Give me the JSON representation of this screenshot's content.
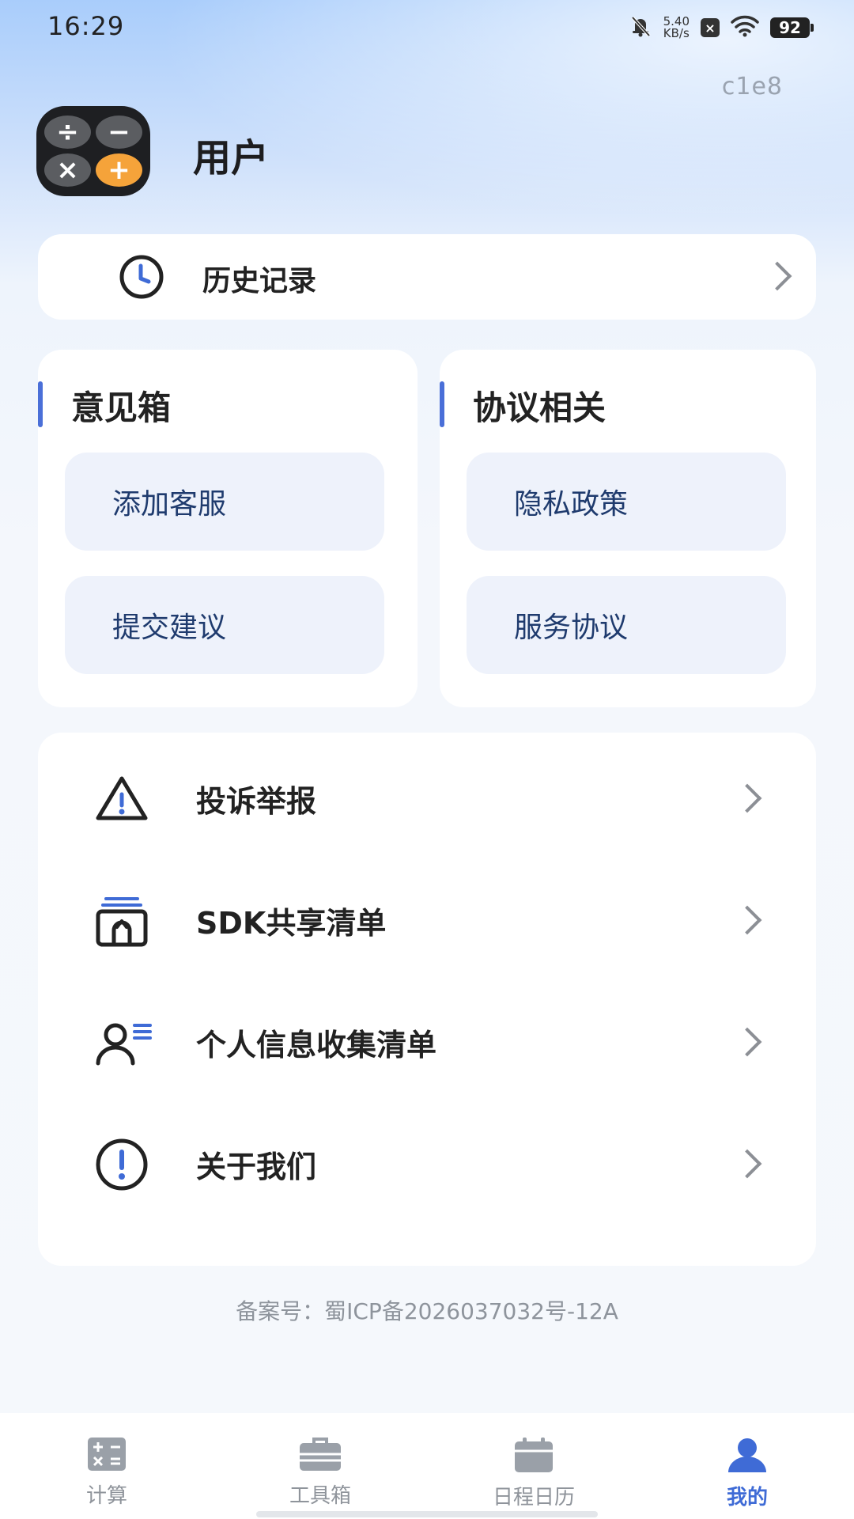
{
  "status_bar": {
    "time": "16:29",
    "net_speed_value": "5.40",
    "net_speed_unit": "KB/s",
    "battery": "92",
    "icons": [
      "mute-bell-icon",
      "x-box-icon",
      "wifi-icon",
      "battery-icon"
    ]
  },
  "version_tag": "c1e8",
  "header": {
    "user_name": "用户",
    "app_icon_keys": [
      "÷",
      "−",
      "×",
      "+"
    ]
  },
  "history": {
    "label": "历史记录",
    "icon": "clock-icon"
  },
  "feedback_section": {
    "title": "意见箱",
    "items": [
      "添加客服",
      "提交建议"
    ]
  },
  "agreement_section": {
    "title": "协议相关",
    "items": [
      "隐私政策",
      "服务协议"
    ]
  },
  "menu_list": [
    {
      "label": "投诉举报",
      "icon": "warning-triangle-icon"
    },
    {
      "label": "SDK共享清单",
      "icon": "share-box-icon"
    },
    {
      "label": "个人信息收集清单",
      "icon": "user-list-icon"
    },
    {
      "label": "关于我们",
      "icon": "info-circle-icon"
    }
  ],
  "icp_text": "备案号：蜀ICP备2026037032号-12A",
  "bottom_nav": {
    "items": [
      {
        "label": "计算",
        "icon": "calculator-icon",
        "active": false
      },
      {
        "label": "工具箱",
        "icon": "toolbox-icon",
        "active": false
      },
      {
        "label": "日程日历",
        "icon": "calendar-icon",
        "active": false
      },
      {
        "label": "我的",
        "icon": "profile-icon",
        "active": true
      }
    ]
  },
  "colors": {
    "accent": "#3f6bd6",
    "pill_bg": "#eef2fb",
    "pill_text": "#1f3b6e",
    "app_icon_orange": "#f5a33a"
  }
}
